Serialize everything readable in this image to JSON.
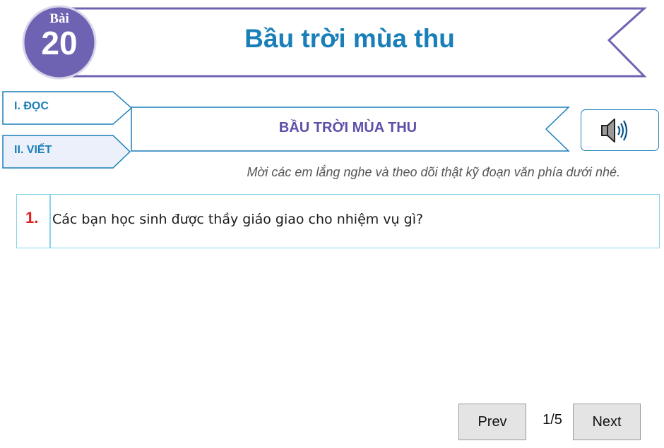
{
  "header": {
    "lesson_word": "Bài",
    "lesson_number": "20",
    "title": "Bầu trời mùa thu"
  },
  "tabs": [
    {
      "label": "I. ĐỌC"
    },
    {
      "label": "II. VIẾT"
    }
  ],
  "section": {
    "title": "BẦU TRỜI MÙA THU",
    "audio_icon": "speaker-icon"
  },
  "instruction": "Mời các em lắng nghe và theo dõi thật kỹ đoạn văn phía dưới nhé.",
  "question": {
    "number": "1.",
    "text": "Các bạn học sinh được thầy giáo giao cho nhiệm vụ gì?"
  },
  "pagination": {
    "prev_label": "Prev",
    "page_indicator": "1/5",
    "next_label": "Next"
  },
  "colors": {
    "accent_purple": "#6e63b3",
    "accent_blue": "#1a7fb8",
    "question_number": "#e01e1e",
    "question_border": "#86d3ea"
  }
}
